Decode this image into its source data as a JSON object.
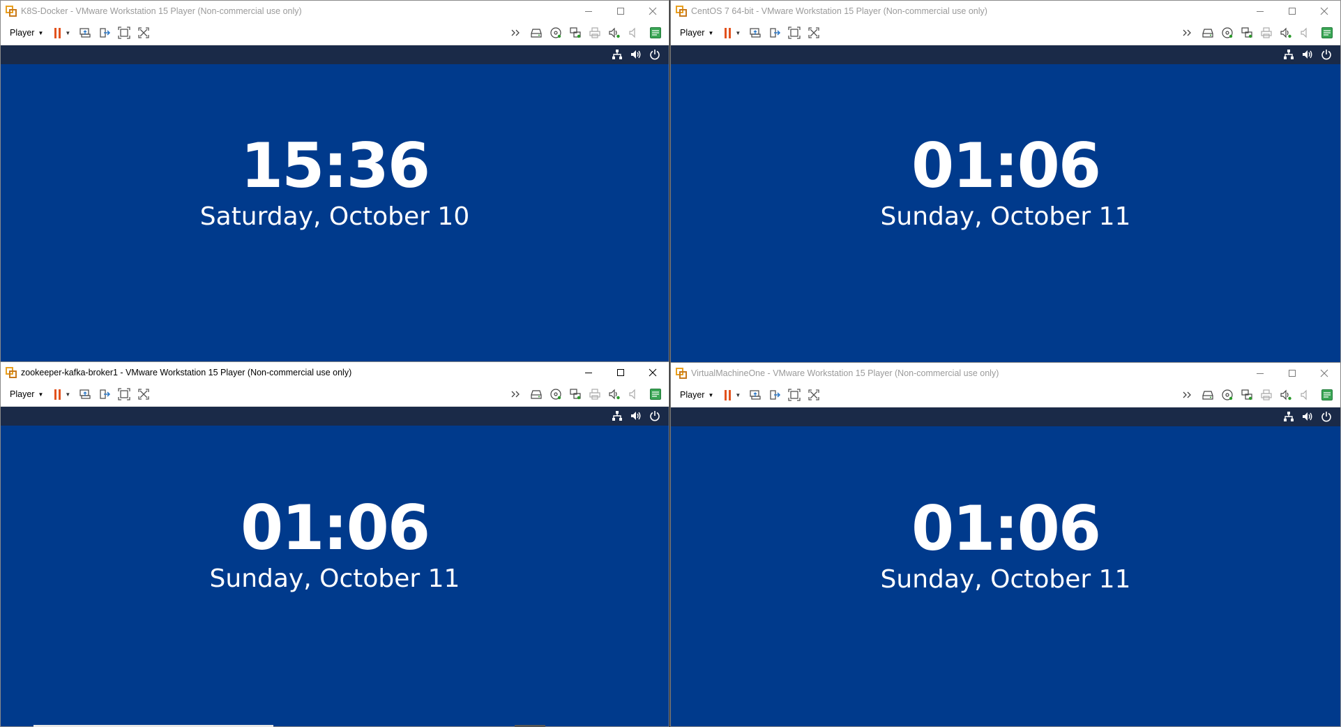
{
  "windows": [
    {
      "title": "K8S-Docker - VMware Workstation 15 Player (Non-commercial use only)",
      "menu": "Player",
      "time": "15:36",
      "date": "Saturday, October 10",
      "active": false
    },
    {
      "title": "CentOS 7 64-bit - VMware Workstation 15 Player (Non-commercial use only)",
      "menu": "Player",
      "time": "01:06",
      "date": "Sunday, October 11",
      "active": false
    },
    {
      "title": "zookeeper-kafka-broker1 - VMware Workstation 15 Player (Non-commercial use only)",
      "menu": "Player",
      "time": "01:06",
      "date": "Sunday, October 11",
      "active": true
    },
    {
      "title": "VirtualMachineOne - VMware Workstation 15 Player (Non-commercial use only)",
      "menu": "Player",
      "time": "01:06",
      "date": "Sunday, October 11",
      "active": false
    }
  ],
  "colors": {
    "guest_background": "#003a8c",
    "guest_topbar": "#1a2a48",
    "pause_orange": "#e2521d"
  },
  "icons": {
    "toolbar_left": [
      "pause-icon",
      "send-ctrl-alt-del-icon",
      "removable-devices-icon",
      "full-screen-icon",
      "unity-icon"
    ],
    "toolbar_right": [
      "more-devices-icon",
      "hard-disk-icon",
      "cd-dvd-icon",
      "network-adapter-icon",
      "printer-icon",
      "sound-card-icon",
      "sound-muted-icon",
      "message-log-icon"
    ],
    "guest_status": [
      "network-icon",
      "volume-icon",
      "power-icon"
    ]
  }
}
